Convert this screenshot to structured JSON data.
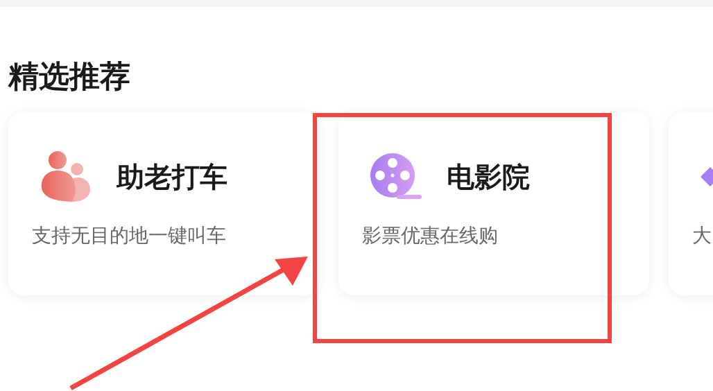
{
  "section": {
    "title": "精选推荐"
  },
  "cards": [
    {
      "kind": "people",
      "title": "助老打车",
      "subtitle": "支持无目的地一键叫车"
    },
    {
      "kind": "film",
      "title": "电影院",
      "subtitle": "影票优惠在线购"
    },
    {
      "kind": "diamond",
      "subtitle": "大"
    }
  ]
}
